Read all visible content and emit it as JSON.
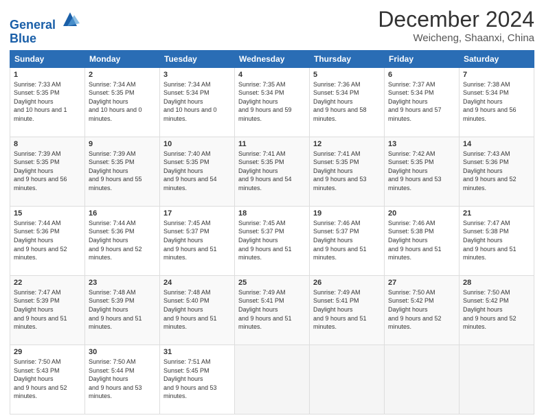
{
  "logo": {
    "line1": "General",
    "line2": "Blue"
  },
  "header": {
    "month": "December 2024",
    "location": "Weicheng, Shaanxi, China"
  },
  "weekdays": [
    "Sunday",
    "Monday",
    "Tuesday",
    "Wednesday",
    "Thursday",
    "Friday",
    "Saturday"
  ],
  "weeks": [
    [
      {
        "day": "1",
        "sunrise": "7:33 AM",
        "sunset": "5:35 PM",
        "daylight": "10 hours and 1 minute."
      },
      {
        "day": "2",
        "sunrise": "7:34 AM",
        "sunset": "5:35 PM",
        "daylight": "10 hours and 0 minutes."
      },
      {
        "day": "3",
        "sunrise": "7:34 AM",
        "sunset": "5:34 PM",
        "daylight": "10 hours and 0 minutes."
      },
      {
        "day": "4",
        "sunrise": "7:35 AM",
        "sunset": "5:34 PM",
        "daylight": "9 hours and 59 minutes."
      },
      {
        "day": "5",
        "sunrise": "7:36 AM",
        "sunset": "5:34 PM",
        "daylight": "9 hours and 58 minutes."
      },
      {
        "day": "6",
        "sunrise": "7:37 AM",
        "sunset": "5:34 PM",
        "daylight": "9 hours and 57 minutes."
      },
      {
        "day": "7",
        "sunrise": "7:38 AM",
        "sunset": "5:34 PM",
        "daylight": "9 hours and 56 minutes."
      }
    ],
    [
      {
        "day": "8",
        "sunrise": "7:39 AM",
        "sunset": "5:35 PM",
        "daylight": "9 hours and 56 minutes."
      },
      {
        "day": "9",
        "sunrise": "7:39 AM",
        "sunset": "5:35 PM",
        "daylight": "9 hours and 55 minutes."
      },
      {
        "day": "10",
        "sunrise": "7:40 AM",
        "sunset": "5:35 PM",
        "daylight": "9 hours and 54 minutes."
      },
      {
        "day": "11",
        "sunrise": "7:41 AM",
        "sunset": "5:35 PM",
        "daylight": "9 hours and 54 minutes."
      },
      {
        "day": "12",
        "sunrise": "7:41 AM",
        "sunset": "5:35 PM",
        "daylight": "9 hours and 53 minutes."
      },
      {
        "day": "13",
        "sunrise": "7:42 AM",
        "sunset": "5:35 PM",
        "daylight": "9 hours and 53 minutes."
      },
      {
        "day": "14",
        "sunrise": "7:43 AM",
        "sunset": "5:36 PM",
        "daylight": "9 hours and 52 minutes."
      }
    ],
    [
      {
        "day": "15",
        "sunrise": "7:44 AM",
        "sunset": "5:36 PM",
        "daylight": "9 hours and 52 minutes."
      },
      {
        "day": "16",
        "sunrise": "7:44 AM",
        "sunset": "5:36 PM",
        "daylight": "9 hours and 52 minutes."
      },
      {
        "day": "17",
        "sunrise": "7:45 AM",
        "sunset": "5:37 PM",
        "daylight": "9 hours and 51 minutes."
      },
      {
        "day": "18",
        "sunrise": "7:45 AM",
        "sunset": "5:37 PM",
        "daylight": "9 hours and 51 minutes."
      },
      {
        "day": "19",
        "sunrise": "7:46 AM",
        "sunset": "5:37 PM",
        "daylight": "9 hours and 51 minutes."
      },
      {
        "day": "20",
        "sunrise": "7:46 AM",
        "sunset": "5:38 PM",
        "daylight": "9 hours and 51 minutes."
      },
      {
        "day": "21",
        "sunrise": "7:47 AM",
        "sunset": "5:38 PM",
        "daylight": "9 hours and 51 minutes."
      }
    ],
    [
      {
        "day": "22",
        "sunrise": "7:47 AM",
        "sunset": "5:39 PM",
        "daylight": "9 hours and 51 minutes."
      },
      {
        "day": "23",
        "sunrise": "7:48 AM",
        "sunset": "5:39 PM",
        "daylight": "9 hours and 51 minutes."
      },
      {
        "day": "24",
        "sunrise": "7:48 AM",
        "sunset": "5:40 PM",
        "daylight": "9 hours and 51 minutes."
      },
      {
        "day": "25",
        "sunrise": "7:49 AM",
        "sunset": "5:41 PM",
        "daylight": "9 hours and 51 minutes."
      },
      {
        "day": "26",
        "sunrise": "7:49 AM",
        "sunset": "5:41 PM",
        "daylight": "9 hours and 51 minutes."
      },
      {
        "day": "27",
        "sunrise": "7:50 AM",
        "sunset": "5:42 PM",
        "daylight": "9 hours and 52 minutes."
      },
      {
        "day": "28",
        "sunrise": "7:50 AM",
        "sunset": "5:42 PM",
        "daylight": "9 hours and 52 minutes."
      }
    ],
    [
      {
        "day": "29",
        "sunrise": "7:50 AM",
        "sunset": "5:43 PM",
        "daylight": "9 hours and 52 minutes."
      },
      {
        "day": "30",
        "sunrise": "7:50 AM",
        "sunset": "5:44 PM",
        "daylight": "9 hours and 53 minutes."
      },
      {
        "day": "31",
        "sunrise": "7:51 AM",
        "sunset": "5:45 PM",
        "daylight": "9 hours and 53 minutes."
      },
      null,
      null,
      null,
      null
    ]
  ]
}
